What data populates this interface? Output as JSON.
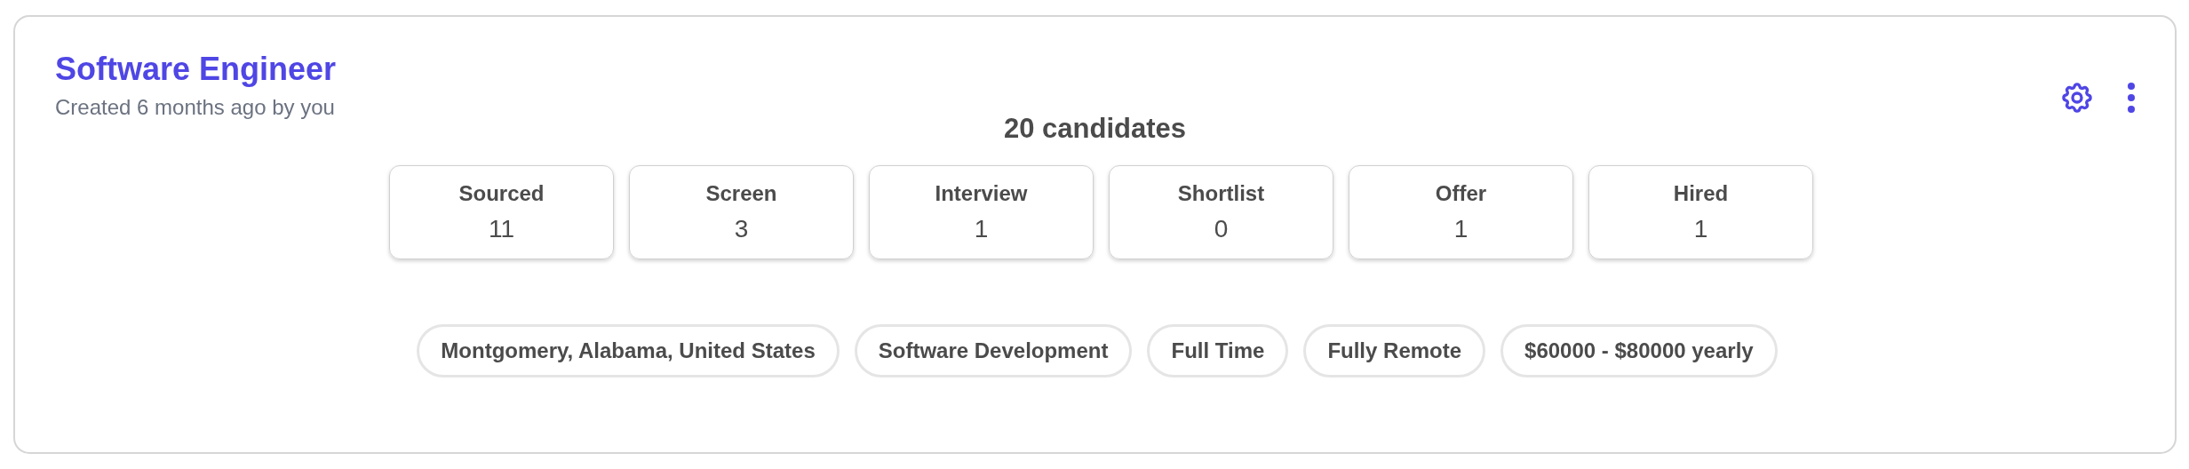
{
  "job": {
    "title": "Software Engineer",
    "subtitle": "Created 6 months ago by you"
  },
  "summary": "20 candidates",
  "stages": [
    {
      "label": "Sourced",
      "count": "11"
    },
    {
      "label": "Screen",
      "count": "3"
    },
    {
      "label": "Interview",
      "count": "1"
    },
    {
      "label": "Shortlist",
      "count": "0"
    },
    {
      "label": "Offer",
      "count": "1"
    },
    {
      "label": "Hired",
      "count": "1"
    }
  ],
  "tags": [
    "Montgomery, Alabama, United States",
    "Software Development",
    "Full Time",
    "Fully Remote",
    "$60000 - $80000 yearly"
  ]
}
